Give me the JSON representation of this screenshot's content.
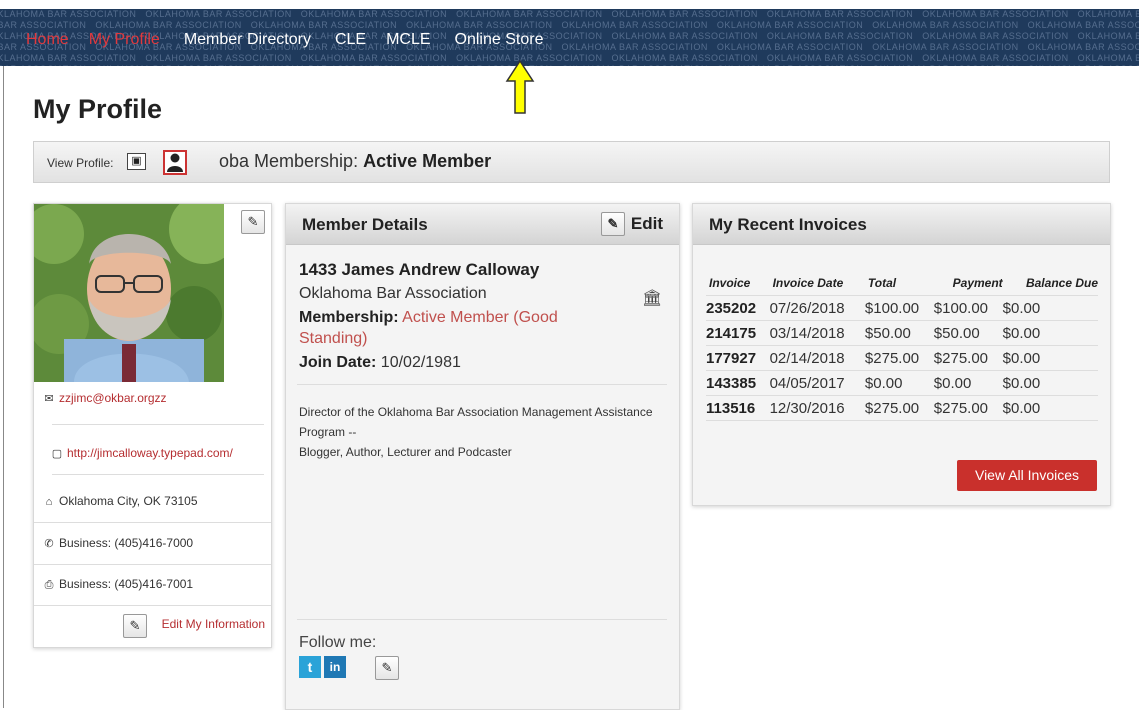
{
  "nav": {
    "brand_pattern": "OKLAHOMA BAR ASSOCIATION",
    "items": [
      {
        "label": "Home"
      },
      {
        "label": "My Profile"
      },
      {
        "label": "Member Directory"
      },
      {
        "label": "CLE"
      },
      {
        "label": "MCLE"
      },
      {
        "label": "Online Store"
      }
    ]
  },
  "page": {
    "title": "My Profile"
  },
  "membership_bar": {
    "view_profile_label": "View Profile:",
    "membership_prefix": "oba Membership:",
    "membership_status": "Active Member"
  },
  "profile_card": {
    "email": "zzjimc@okbar.orgzz",
    "website": "http://jimcalloway.typepad.com/",
    "location": "Oklahoma City, OK 73105",
    "phone": "Business: (405)416-7000",
    "fax": "Business: (405)416-7001",
    "edit_label": "Edit My Information"
  },
  "member_details": {
    "title": "Member Details",
    "edit_label": "Edit",
    "name": "1433 James Andrew Calloway",
    "organization": "Oklahoma Bar Association",
    "membership_label": "Membership:",
    "membership_value": "Active Member (Good Standing)",
    "join_label": "Join Date:",
    "join_date": "10/02/1981",
    "description_line1": "Director of the Oklahoma Bar Association Management Assistance Program --",
    "description_line2": "Blogger, Author, Lecturer and Podcaster",
    "follow_label": "Follow me:",
    "twitter_glyph": "t",
    "linkedin_glyph": "in"
  },
  "invoices": {
    "title": "My Recent Invoices",
    "columns": [
      "Invoice",
      "Invoice Date",
      "Total",
      "Payment",
      "Balance Due"
    ],
    "rows": [
      {
        "invoice": "235202",
        "date": "07/26/2018",
        "total": "$100.00",
        "payment": "$100.00",
        "balance": "$0.00"
      },
      {
        "invoice": "214175",
        "date": "03/14/2018",
        "total": "$50.00",
        "payment": "$50.00",
        "balance": "$0.00"
      },
      {
        "invoice": "177927",
        "date": "02/14/2018",
        "total": "$275.00",
        "payment": "$275.00",
        "balance": "$0.00"
      },
      {
        "invoice": "143385",
        "date": "04/05/2017",
        "total": "$0.00",
        "payment": "$0.00",
        "balance": "$0.00"
      },
      {
        "invoice": "113516",
        "date": "12/30/2016",
        "total": "$275.00",
        "payment": "$275.00",
        "balance": "$0.00"
      }
    ],
    "view_all_label": "View All Invoices"
  },
  "colors": {
    "nav_bg": "#1f3a5c",
    "accent_red": "#c9302c",
    "link_red": "#b52e31",
    "arrow_yellow": "#ffff00"
  }
}
